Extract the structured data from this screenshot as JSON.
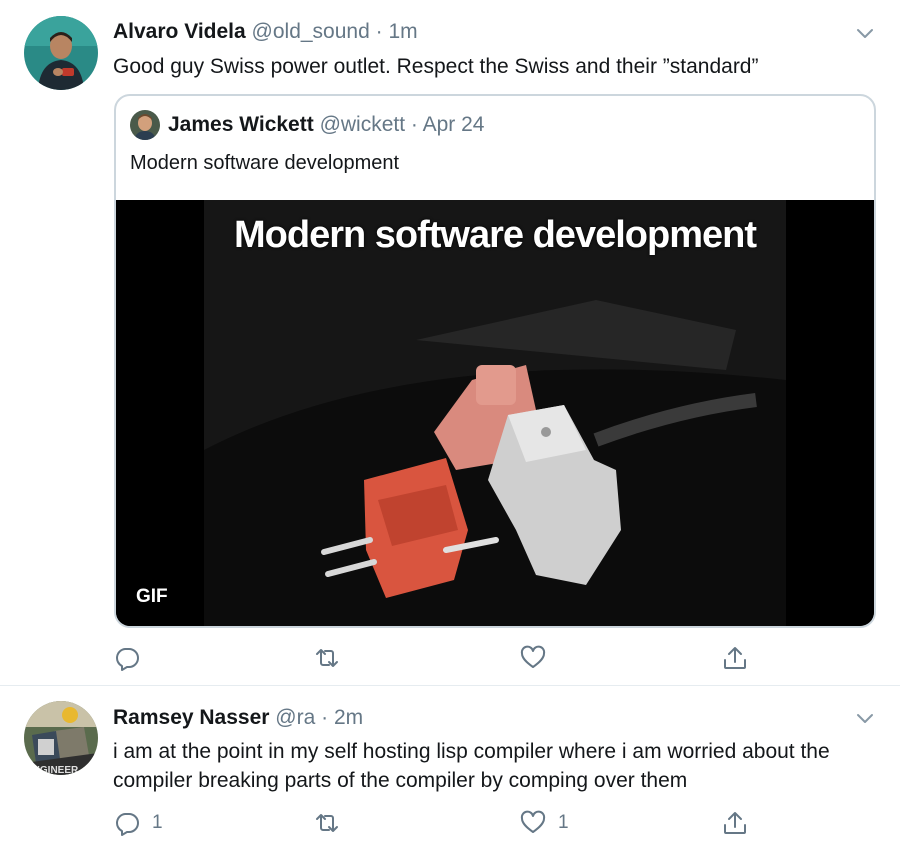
{
  "tweets": [
    {
      "name": "Alvaro Videla",
      "handle": "@old_sound",
      "sep": "·",
      "time": "1m",
      "text": "Good guy Swiss power outlet. Respect the Swiss and their ”standard”",
      "quoted": {
        "name": "James Wickett",
        "handle": "@wickett",
        "sep": "·",
        "time": "Apr 24",
        "text": "Modern software development",
        "media": {
          "caption": "Modern software development",
          "badge": "GIF"
        }
      },
      "counts": {
        "reply": "",
        "retweet": "",
        "like": ""
      }
    },
    {
      "name": "Ramsey Nasser",
      "handle": "@ra",
      "sep": "·",
      "time": "2m",
      "text": "i am at the point in my self hosting lisp compiler where i am worried about the compiler breaking parts of the compiler by comping over them",
      "avatar_text": "ENGINEER",
      "counts": {
        "reply": "1",
        "retweet": "",
        "like": "1"
      }
    }
  ],
  "icons": {
    "reply": "reply-icon",
    "retweet": "retweet-icon",
    "like": "heart-icon",
    "share": "share-icon",
    "more": "chevron-down-icon"
  },
  "colors": {
    "text": "#14171a",
    "muted": "#657786",
    "border": "#e6ecf0",
    "quote_border": "#ccd6dd"
  }
}
